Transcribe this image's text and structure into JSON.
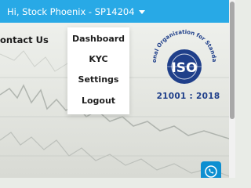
{
  "topbar": {
    "greeting": "Hi, Stock Phoenix - SP14204"
  },
  "nav": {
    "contact_label": "ontact Us"
  },
  "user_menu": {
    "items": [
      {
        "label": "Dashboard"
      },
      {
        "label": "KYC"
      },
      {
        "label": "Settings"
      },
      {
        "label": "Logout"
      }
    ]
  },
  "iso": {
    "arc_text": "International Organization for Standardization",
    "logo_text": "ISO",
    "standard": "21001 : 2018"
  },
  "icons": {
    "caret": "chevron-down-icon",
    "iso_logo": "iso-logo-icon",
    "phone": "phone-icon"
  },
  "colors": {
    "topbar": "#28a9e6",
    "iso_blue": "#1f3f8a",
    "phone_button": "#0d8fd1"
  }
}
